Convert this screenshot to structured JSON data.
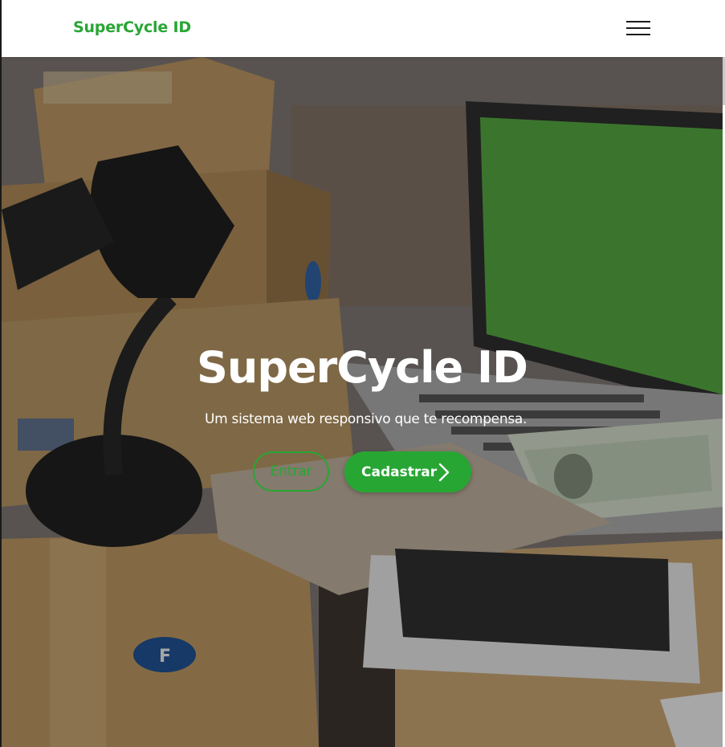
{
  "navbar": {
    "brand": "SuperCycle ID",
    "menu_icon": "hamburger-menu-icon"
  },
  "hero": {
    "title": "SuperCycle ID",
    "subtitle": "Um sistema web responsivo que te recompensa.",
    "enter_label": "Entrar",
    "signup_label": "Cadastrar",
    "signup_icon": "chevron-right-icon"
  },
  "colors": {
    "accent": "#28a634",
    "nav_bg": "#ffffff",
    "hero_text": "#ffffff"
  }
}
